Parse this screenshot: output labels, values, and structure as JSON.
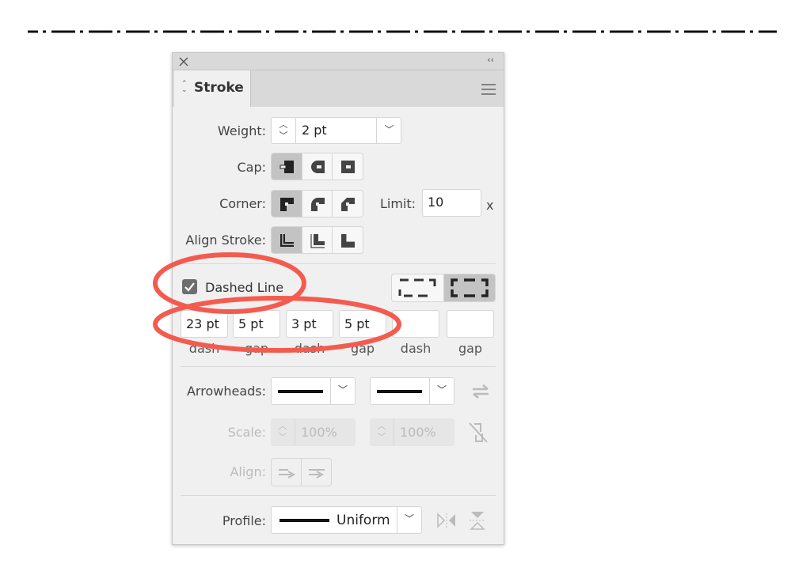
{
  "canvas": {
    "line_color": "#111111",
    "dash_pattern_pt": [
      23,
      5,
      3,
      5
    ]
  },
  "panel": {
    "close_icon": "close-icon",
    "collapse_icon": "double-chevron-left-icon",
    "tab_label": "Stroke",
    "menu_icon": "hamburger-icon",
    "weight": {
      "label": "Weight:",
      "value": "2 pt"
    },
    "cap": {
      "label": "Cap:",
      "selected": "butt"
    },
    "corner": {
      "label": "Corner:",
      "selected": "miter"
    },
    "limit": {
      "label": "Limit:",
      "value": "10",
      "suffix": "x"
    },
    "align_stroke": {
      "label": "Align Stroke:",
      "selected": "center"
    },
    "dashed_line": {
      "label": "Dashed Line",
      "checked": true,
      "selected_mode": "align-to-corners"
    },
    "dash_fields": [
      {
        "value": "23 pt",
        "label": "dash"
      },
      {
        "value": "5 pt",
        "label": "gap"
      },
      {
        "value": "3 pt",
        "label": "dash"
      },
      {
        "value": "5 pt",
        "label": "gap"
      },
      {
        "value": "",
        "label": "dash"
      },
      {
        "value": "",
        "label": "gap"
      }
    ],
    "arrowheads": {
      "label": "Arrowheads:"
    },
    "scale": {
      "label": "Scale:",
      "start": "100%",
      "end": "100%"
    },
    "align": {
      "label": "Align:"
    },
    "profile": {
      "label": "Profile:",
      "value": "Uniform"
    }
  },
  "annotation_color": "#f45b4f"
}
